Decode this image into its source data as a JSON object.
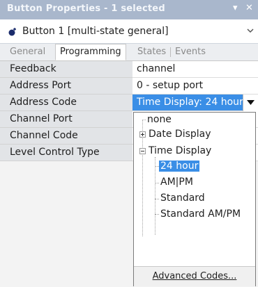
{
  "window": {
    "title": "Button Properties - 1 selected",
    "pin_icon": "pin-icon",
    "close_icon": "close-icon"
  },
  "selector": {
    "value": "Button 1  [multi-state general]",
    "icon": "button-dot-icon"
  },
  "tabs": [
    {
      "label": "General",
      "active": false
    },
    {
      "label": "Programming",
      "active": true
    },
    {
      "label": "States",
      "active": false
    },
    {
      "label": "Events",
      "active": false
    }
  ],
  "properties": [
    {
      "label": "Feedback",
      "value": "channel"
    },
    {
      "label": "Address Port",
      "value": "0 - setup port"
    },
    {
      "label": "Address Code",
      "value": "Time Display: 24 hour"
    },
    {
      "label": "Channel Port",
      "value": ""
    },
    {
      "label": "Channel Code",
      "value": ""
    },
    {
      "label": "Level Control Type",
      "value": ""
    }
  ],
  "dropdown": {
    "items": {
      "none": "none",
      "date_display": "Date Display",
      "time_display": "Time Display",
      "hour24": "24 hour",
      "ampm": "AM|PM",
      "standard": "Standard",
      "standard_ampm": "Standard AM/PM"
    },
    "advanced_label": "Advanced Codes..."
  },
  "colors": {
    "title_bar": "#a9b7cc",
    "selection": "#3a8ee6"
  }
}
